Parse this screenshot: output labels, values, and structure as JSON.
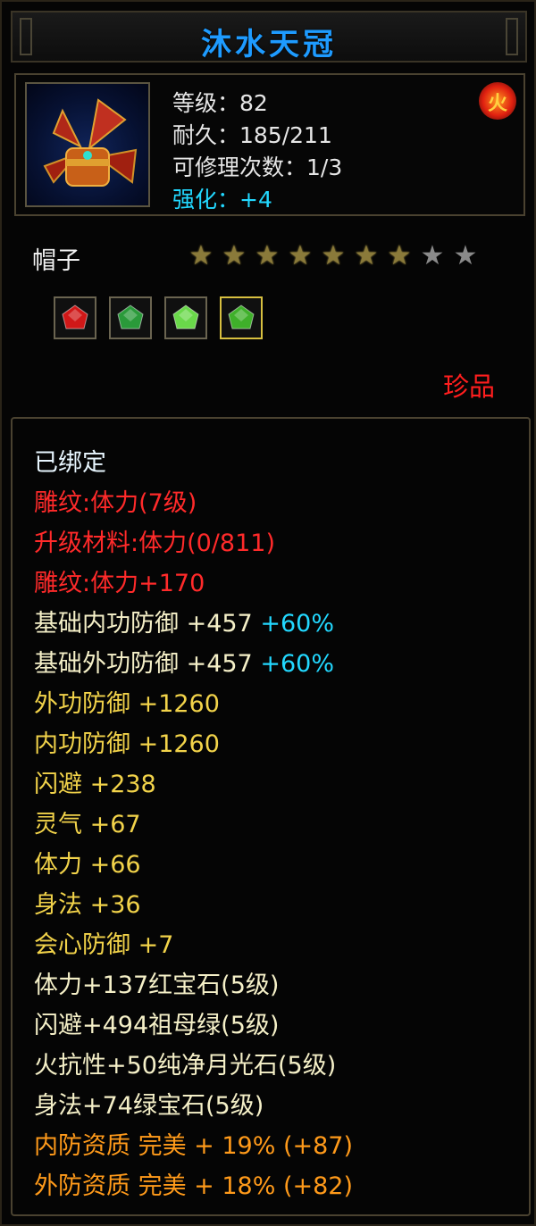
{
  "item": {
    "name": "沐水天冠",
    "level": "等级：82",
    "durability": "耐久：185/211",
    "repair_count": "可修理次数：1/3",
    "enhance": "强化：+4",
    "type": "帽子",
    "star_total": 9,
    "star_filled": 7,
    "rarity": "珍品"
  },
  "gems": [
    {
      "name": "red-gem-icon",
      "color": "#d01818"
    },
    {
      "name": "green-ring-gem-icon",
      "color": "#2a9a3a"
    },
    {
      "name": "green-leaf-gem-icon",
      "color": "#6ad84a"
    },
    {
      "name": "green-faceted-gem-icon",
      "color": "#3fb02a"
    }
  ],
  "attributes": {
    "bound": "已绑定",
    "carve1": "雕纹:体力(7级)",
    "upgrade_material": "升级材料:体力(0/811)",
    "carve2": "雕纹:体力+170",
    "base_inner_def": "基础内功防御 +457",
    "base_inner_def_pct": "+60%",
    "base_outer_def": "基础外功防御 +457",
    "base_outer_def_pct": "+60%",
    "outer_def": "外功防御 +1260",
    "inner_def": "内功防御 +1260",
    "dodge": "闪避 +238",
    "spirit": "灵气 +67",
    "stamina": "体力 +66",
    "agility": "身法 +36",
    "crit_def": "会心防御 +7",
    "gem1": "体力+137红宝石(5级)",
    "gem2": "闪避+494祖母绿(5级)",
    "gem3": "火抗性+50纯净月光石(5级)",
    "gem4": "身法+74绿宝石(5级)",
    "inner_quality": "内防资质 完美 + 19% (+87)",
    "outer_quality": "外防资质 完美 + 18% (+82)"
  }
}
